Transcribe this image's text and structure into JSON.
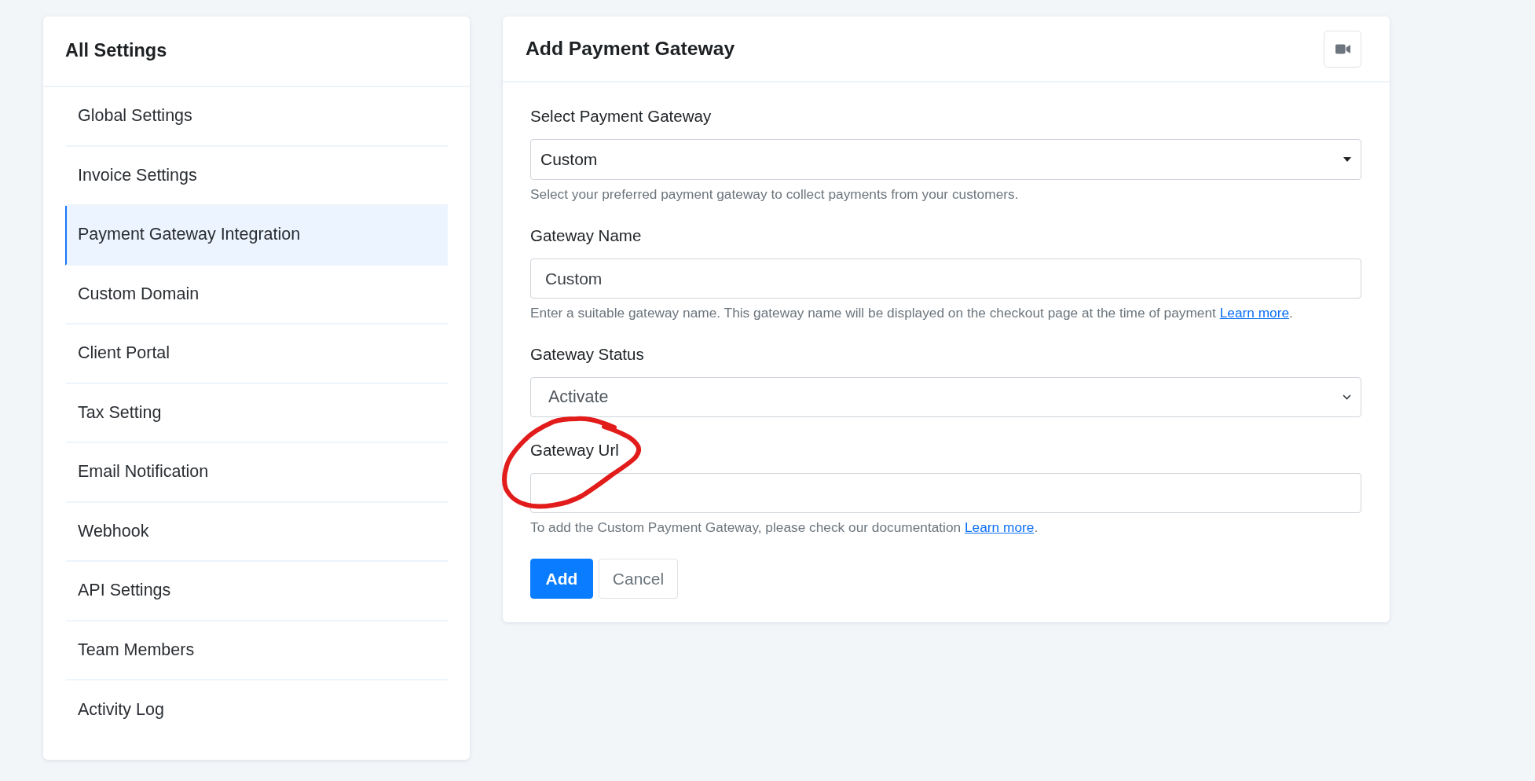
{
  "sidebar": {
    "title": "All Settings",
    "items": [
      {
        "label": "Global Settings",
        "selected": false
      },
      {
        "label": "Invoice Settings",
        "selected": false
      },
      {
        "label": "Payment Gateway Integration",
        "selected": true
      },
      {
        "label": "Custom Domain",
        "selected": false
      },
      {
        "label": "Client Portal",
        "selected": false
      },
      {
        "label": "Tax Setting",
        "selected": false
      },
      {
        "label": "Email Notification",
        "selected": false
      },
      {
        "label": "Webhook",
        "selected": false
      },
      {
        "label": "API Settings",
        "selected": false
      },
      {
        "label": "Team Members",
        "selected": false
      },
      {
        "label": "Activity Log",
        "selected": false
      }
    ]
  },
  "form": {
    "title": "Add Payment Gateway",
    "fields": [
      {
        "kind": "dropdown",
        "label": "Select Payment Gateway",
        "value": "Custom",
        "help": "Select your preferred payment gateway to collect payments from your customers.",
        "circled": false
      },
      {
        "kind": "text",
        "label": "Gateway Name",
        "value": "Custom",
        "help": "Enter a suitable gateway name. This gateway name will be displayed on the checkout page at the time of payment",
        "link": "Learn more",
        "help_end": ".",
        "circled": false
      },
      {
        "kind": "select",
        "label": "Gateway Status",
        "value": "Activate",
        "circled": false
      },
      {
        "kind": "text",
        "label": "Gateway Url",
        "help": "To add the Custom Payment Gateway, please check our documentation",
        "link": "Learn more",
        "help_end": ".",
        "circled": true
      }
    ],
    "buttons": [
      {
        "label": "Add",
        "kind": "primary"
      },
      {
        "label": "Cancel",
        "kind": "secondary"
      }
    ]
  }
}
